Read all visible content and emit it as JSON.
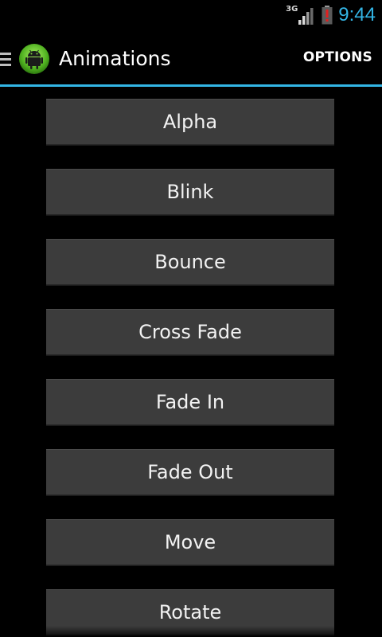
{
  "status_bar": {
    "network": "3G",
    "time": "9:44",
    "icons": [
      "signal-icon",
      "battery-alert-icon"
    ],
    "colors": {
      "clock": "#33b5e5",
      "battery_alert": "#e02020"
    }
  },
  "action_bar": {
    "icons": [
      "drawer-icon",
      "android-app-icon"
    ],
    "title": "Animations",
    "options_label": "OPTIONS",
    "colors": {
      "divider": "#33b5e5"
    }
  },
  "buttons": [
    {
      "label": "Alpha"
    },
    {
      "label": "Blink"
    },
    {
      "label": "Bounce"
    },
    {
      "label": "Cross Fade"
    },
    {
      "label": "Fade In"
    },
    {
      "label": "Fade Out"
    },
    {
      "label": "Move"
    },
    {
      "label": "Rotate"
    }
  ]
}
